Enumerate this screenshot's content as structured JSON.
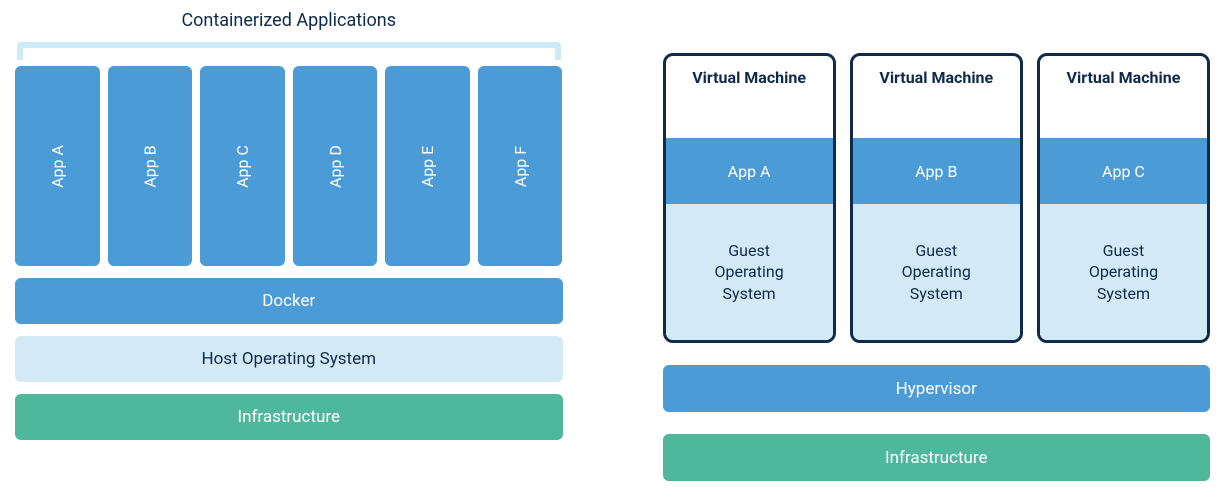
{
  "left": {
    "title": "Containerized Applications",
    "apps": [
      "App A",
      "App B",
      "App C",
      "App D",
      "App E",
      "App F"
    ],
    "docker": "Docker",
    "host_os": "Host Operating System",
    "infra": "Infrastructure"
  },
  "right": {
    "vms": [
      {
        "title": "Virtual Machine",
        "app": "App A",
        "guest": "Guest\nOperating\nSystem"
      },
      {
        "title": "Virtual Machine",
        "app": "App B",
        "guest": "Guest\nOperating\nSystem"
      },
      {
        "title": "Virtual Machine",
        "app": "App C",
        "guest": "Guest\nOperating\nSystem"
      }
    ],
    "hypervisor": "Hypervisor",
    "infra": "Infrastructure"
  }
}
